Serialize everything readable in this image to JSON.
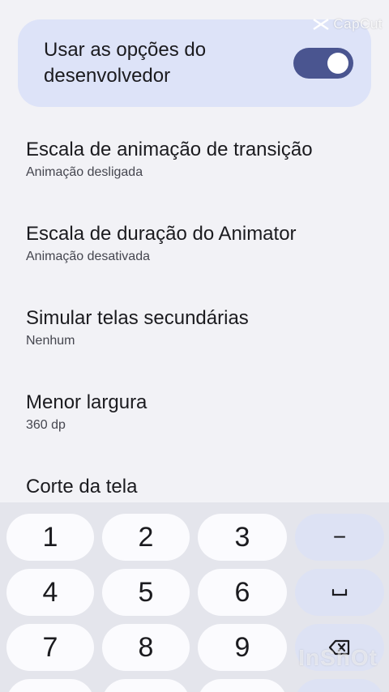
{
  "watermarks": {
    "top": "CapCut",
    "bottom": "InShOt"
  },
  "developer_options": {
    "label": "Usar as opções do desenvolvedor",
    "toggle_on": true
  },
  "settings": [
    {
      "title": "Escala de animação de transição",
      "subtitle": "Animação desligada"
    },
    {
      "title": "Escala de duração do Animator",
      "subtitle": "Animação desativada"
    },
    {
      "title": "Simular telas secundárias",
      "subtitle": "Nenhum"
    },
    {
      "title": "Menor largura",
      "subtitle": "360 dp"
    },
    {
      "title": "Corte da tela",
      "subtitle": ""
    }
  ],
  "keypad": {
    "rows": [
      [
        "1",
        "2",
        "3"
      ],
      [
        "4",
        "5",
        "6"
      ],
      [
        "7",
        "8",
        "9"
      ]
    ],
    "function_keys": [
      "minus-icon",
      "space-icon",
      "backspace-icon"
    ],
    "function_labels": [
      "−",
      "␣",
      "⌫"
    ]
  },
  "colors": {
    "card_bg": "#dde3f8",
    "toggle_track": "#4a5590",
    "keypad_bg": "#e4e5ec",
    "function_key_bg": "#dde2f4"
  }
}
